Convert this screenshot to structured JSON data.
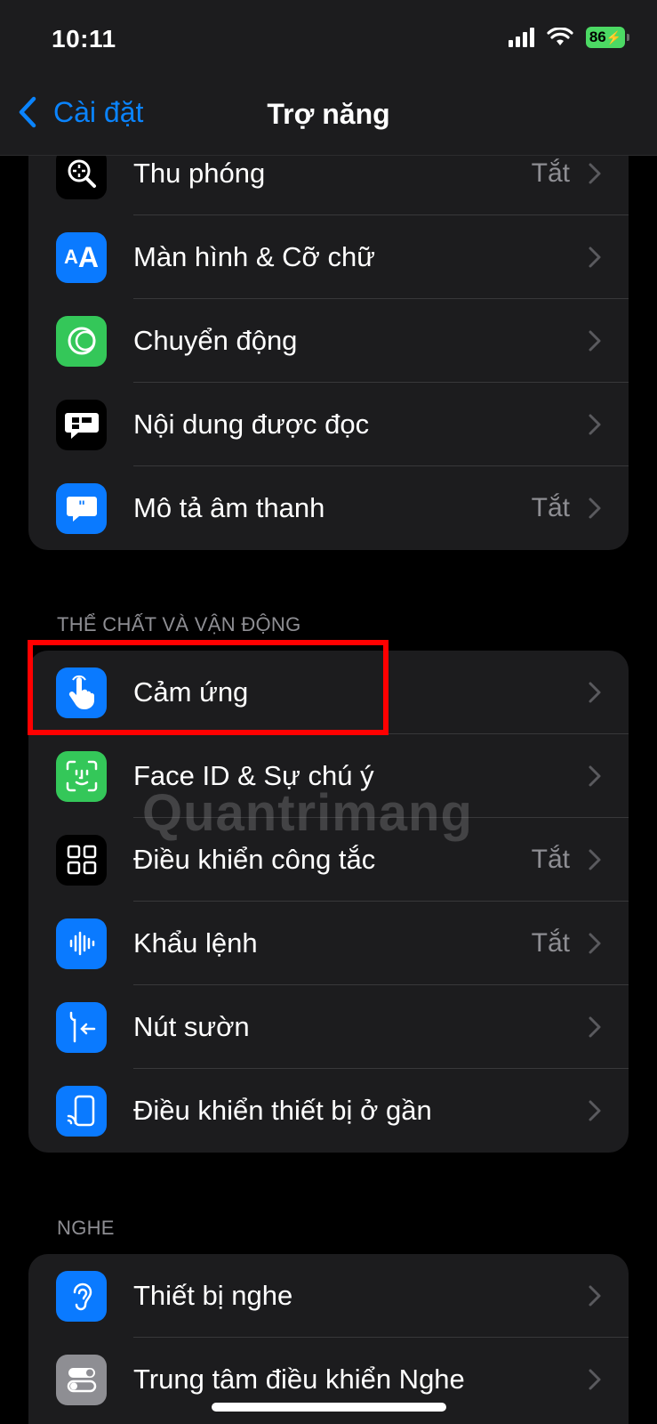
{
  "status_bar": {
    "time": "10:11",
    "battery": "86"
  },
  "nav": {
    "back_label": "Cài đặt",
    "title": "Trợ năng"
  },
  "vision_group": {
    "items": [
      {
        "label": "Thu phóng",
        "value": "Tắt",
        "icon": "zoom-icon",
        "color": "#000000"
      },
      {
        "label": "Màn hình & Cỡ chữ",
        "value": "",
        "icon": "text-size-icon",
        "color": "#0a7aff"
      },
      {
        "label": "Chuyển động",
        "value": "",
        "icon": "motion-icon",
        "color": "#34c759"
      },
      {
        "label": "Nội dung được đọc",
        "value": "",
        "icon": "spoken-content-icon",
        "color": "#000000"
      },
      {
        "label": "Mô tả âm thanh",
        "value": "Tắt",
        "icon": "audio-description-icon",
        "color": "#0a7aff"
      }
    ]
  },
  "physical_section": {
    "header": "THỂ CHẤT VÀ VẬN ĐỘNG"
  },
  "physical_group": {
    "items": [
      {
        "label": "Cảm ứng",
        "value": "",
        "icon": "touch-hand-icon",
        "color": "#0a7aff"
      },
      {
        "label": "Face ID & Sự chú ý",
        "value": "",
        "icon": "face-id-icon",
        "color": "#34c759"
      },
      {
        "label": "Điều khiển công tắc",
        "value": "Tắt",
        "icon": "switch-control-icon",
        "color": "#000000"
      },
      {
        "label": "Khẩu lệnh",
        "value": "Tắt",
        "icon": "voice-control-icon",
        "color": "#0a7aff"
      },
      {
        "label": "Nút sườn",
        "value": "",
        "icon": "side-button-icon",
        "color": "#0a7aff"
      },
      {
        "label": "Điều khiển thiết bị ở gần",
        "value": "",
        "icon": "nearby-devices-icon",
        "color": "#0a7aff"
      }
    ]
  },
  "hearing_section": {
    "header": "NGHE"
  },
  "hearing_group": {
    "items": [
      {
        "label": "Thiết bị nghe",
        "value": "",
        "icon": "ear-icon",
        "color": "#0a7aff"
      },
      {
        "label": "Trung tâm điều khiển Nghe",
        "value": "",
        "icon": "toggles-icon",
        "color": "#8e8e93"
      }
    ]
  },
  "watermark": "Quantrimang",
  "colors": {
    "accent": "#0a84ff",
    "highlight": "#ff0000",
    "battery": "#4cd964"
  }
}
